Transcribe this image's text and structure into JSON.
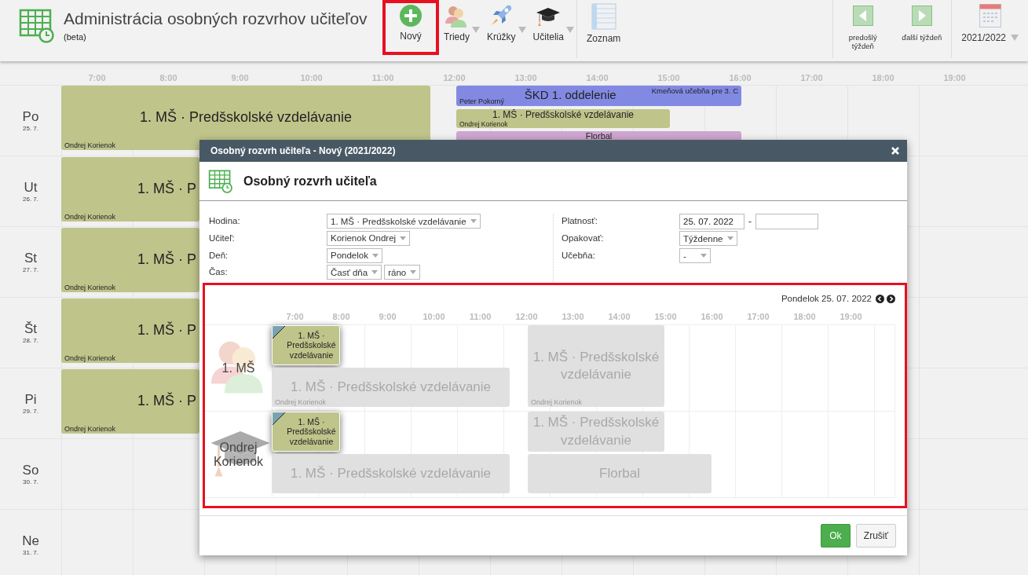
{
  "app": {
    "title": "Administrácia osobných rozvrhov učiteľov",
    "subtitle": "(beta)"
  },
  "toolbar": [
    {
      "kind": "add",
      "label": "Nový",
      "dropdown": false,
      "highlighted": true
    },
    {
      "kind": "classes",
      "label": "Triedy",
      "dropdown": true,
      "highlighted": false
    },
    {
      "kind": "clubs",
      "label": "Krúžky",
      "dropdown": true,
      "highlighted": false
    },
    {
      "kind": "teachers",
      "label": "Učitelia",
      "dropdown": true,
      "highlighted": false
    },
    {
      "kind": "list",
      "label": "Zoznam",
      "dropdown": false,
      "highlighted": false
    }
  ],
  "week_nav": [
    {
      "kind": "prev",
      "label": "predošlý týždeň"
    },
    {
      "kind": "next",
      "label": "ďalší týždeň"
    }
  ],
  "year_selector": {
    "label": "2021/2022"
  },
  "schedule": {
    "hours": [
      "7:00",
      "8:00",
      "9:00",
      "10:00",
      "11:00",
      "12:00",
      "13:00",
      "14:00",
      "15:00",
      "16:00",
      "17:00",
      "18:00",
      "19:00"
    ],
    "days": [
      {
        "name": "Po",
        "date": "25. 7.",
        "events": [
          {
            "title": "1. MŠ · Predšskolské vzdelávanie",
            "teacher": "Ondrej Korienok",
            "color": "#bfc48a"
          },
          {
            "title": "ŠKD 1. oddelenie",
            "teacher": "Peter Pokorný",
            "room": "Kmeňová učebňa pre 3. C",
            "color": "#8289e3"
          },
          {
            "title": "1. MŠ · Predšskolské vzdelávanie",
            "teacher": "Ondrej Korienok",
            "color": "#bfc48a"
          },
          {
            "title": "Florbal",
            "color": "#cea6cf"
          }
        ]
      },
      {
        "name": "Ut",
        "date": "26. 7.",
        "events": [
          {
            "title": "1. MŠ · P",
            "teacher": "Ondrej Korienok",
            "color": "#bfc48a"
          }
        ]
      },
      {
        "name": "St",
        "date": "27. 7.",
        "events": [
          {
            "title": "1. MŠ · P",
            "teacher": "Ondrej Korienok",
            "color": "#bfc48a"
          }
        ]
      },
      {
        "name": "Št",
        "date": "28. 7.",
        "events": [
          {
            "title": "1. MŠ · P",
            "teacher": "Ondrej Korienok",
            "color": "#bfc48a"
          }
        ]
      },
      {
        "name": "Pi",
        "date": "29. 7.",
        "events": [
          {
            "title": "1. MŠ · P",
            "teacher": "Ondrej Korienok",
            "color": "#bfc48a"
          }
        ]
      },
      {
        "name": "So",
        "date": "30. 7."
      },
      {
        "name": "Ne",
        "date": "31. 7."
      }
    ]
  },
  "dialog": {
    "title": "Osobný rozvrh učiteľa - Nový (2021/2022)",
    "heading": "Osobný rozvrh učiteľa",
    "form_left": [
      {
        "label": "Hodina:",
        "controls": [
          {
            "kind": "select",
            "value": "1. MŠ · Predšskolské vzdelávanie"
          }
        ]
      },
      {
        "label": "Učiteľ:",
        "controls": [
          {
            "kind": "select",
            "value": "Korienok Ondrej"
          }
        ]
      },
      {
        "label": "Deň:",
        "controls": [
          {
            "kind": "select",
            "value": "Pondelok"
          }
        ]
      },
      {
        "label": "Čas:",
        "controls": [
          {
            "kind": "select",
            "value": "Časť dňa"
          },
          {
            "kind": "select",
            "value": "ráno"
          }
        ]
      }
    ],
    "form_right": [
      {
        "label": "Platnosť:",
        "controls": [
          {
            "kind": "input",
            "value": "25. 07. 2022"
          },
          {
            "kind": "separator",
            "value": "-"
          },
          {
            "kind": "input"
          }
        ]
      },
      {
        "label": "Opakovať:",
        "controls": [
          {
            "kind": "select",
            "value": "Týždenne"
          }
        ]
      },
      {
        "label": "Učebňa:",
        "controls": [
          {
            "kind": "select",
            "value": "-"
          }
        ]
      }
    ],
    "preview": {
      "highlighted": true,
      "date": "Pondelok 25. 07. 2022",
      "hours": [
        "7:00",
        "8:00",
        "9:00",
        "10:00",
        "11:00",
        "12:00",
        "13:00",
        "14:00",
        "15:00",
        "16:00",
        "17:00",
        "18:00",
        "19:00"
      ],
      "rows": [
        {
          "kind": "class",
          "label": "1. MŠ",
          "events": [
            {
              "title": "1. MŠ · Predšskolské vzdelávanie",
              "selected": true
            },
            {
              "title": "1. MŠ · Predšskolské vzdelávanie",
              "teacher": "Ondrej Korienok",
              "selected": false
            },
            {
              "title": "1. MŠ · Predšskolské vzdelávanie",
              "teacher": "Ondrej Korienok",
              "selected": false
            }
          ]
        },
        {
          "kind": "teacher",
          "label": "Ondrej Korienok",
          "events": [
            {
              "title": "1. MŠ · Predšskolské vzdelávanie",
              "selected": true
            },
            {
              "title": "1. MŠ · Predšskolské vzdelávanie",
              "selected": false
            },
            {
              "title": "1. MŠ · Predšskolské vzdelávanie",
              "selected": false
            },
            {
              "title": "Florbal",
              "selected": false
            }
          ]
        }
      ]
    },
    "buttons": [
      {
        "kind": "primary",
        "label": "Ok"
      },
      {
        "kind": "secondary",
        "label": "Zrušiť"
      }
    ]
  }
}
